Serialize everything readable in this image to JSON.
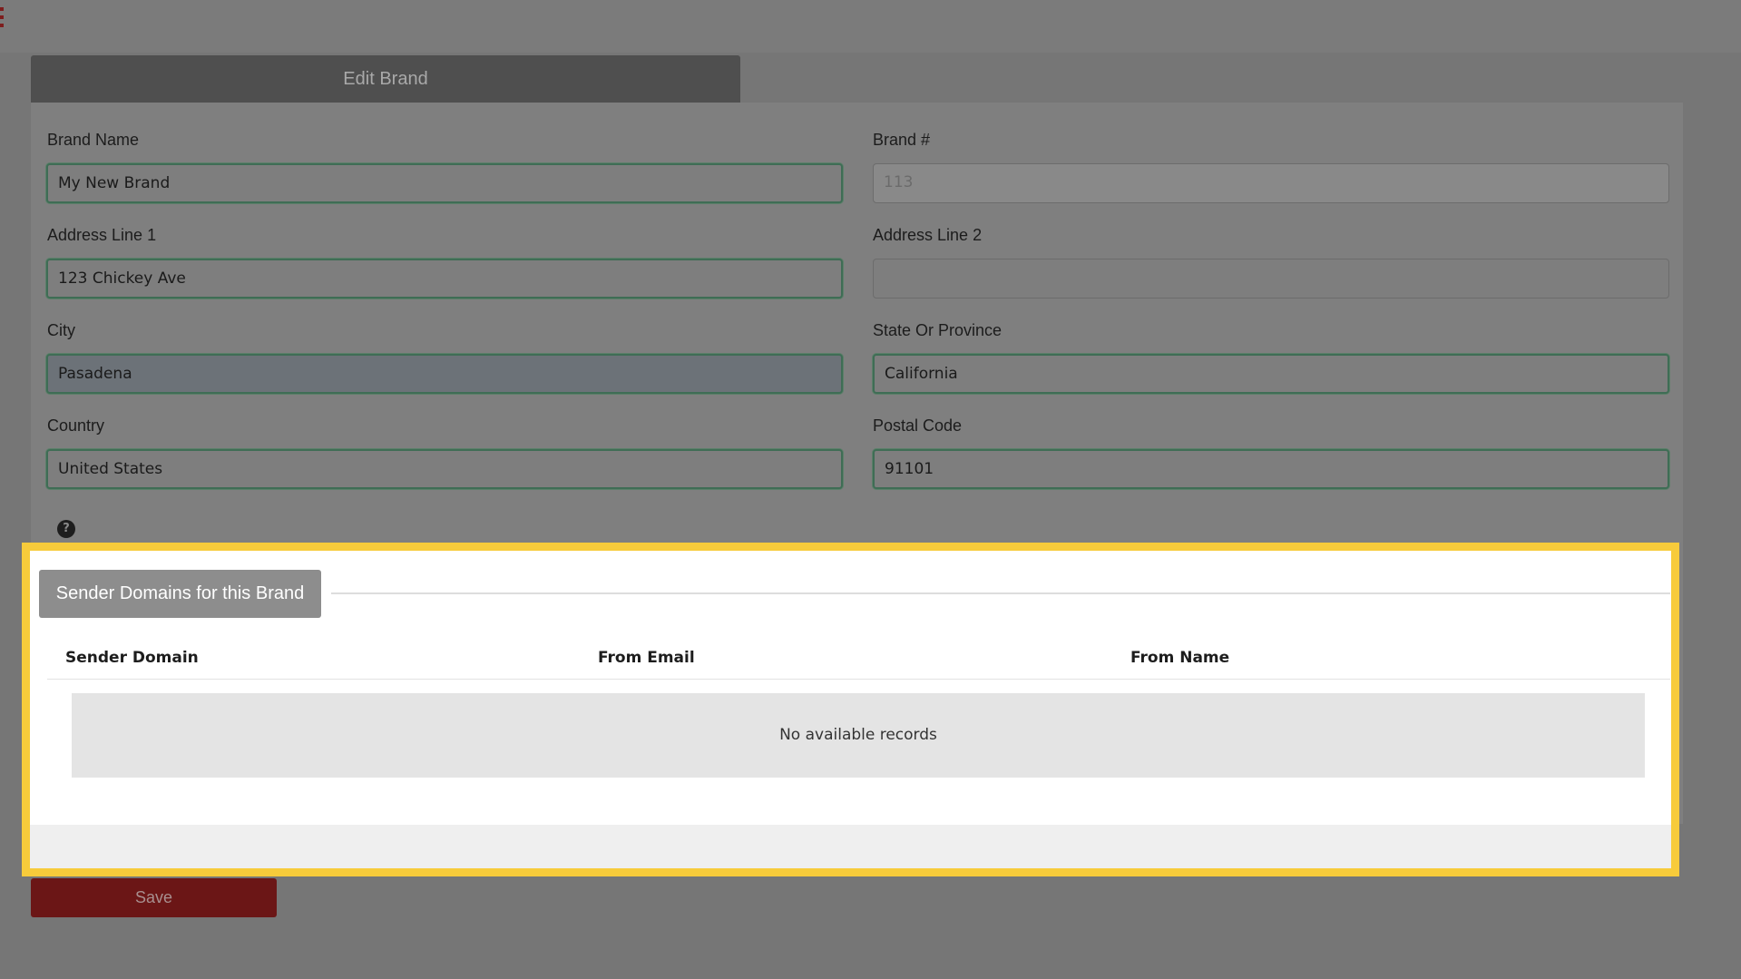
{
  "panel": {
    "title": "Edit Brand"
  },
  "form": {
    "brand_name": {
      "label": "Brand Name",
      "value": "My New Brand"
    },
    "brand_number": {
      "label": "Brand #",
      "value": "113"
    },
    "address_line_1": {
      "label": "Address Line 1",
      "value": "123 Chickey Ave"
    },
    "address_line_2": {
      "label": "Address Line 2",
      "value": ""
    },
    "city": {
      "label": "City",
      "value": "Pasadena"
    },
    "state": {
      "label": "State Or Province",
      "value": "California"
    },
    "country": {
      "label": "Country",
      "value": "United States"
    },
    "postal_code": {
      "label": "Postal Code",
      "value": "91101"
    },
    "help_icon": "question-icon"
  },
  "sender_domains": {
    "title": "Sender Domains for this Brand",
    "columns": [
      "Sender Domain",
      "From Email",
      "From Name"
    ],
    "empty_message": "No available records"
  },
  "actions": {
    "save_label": "Save"
  },
  "colors": {
    "highlight_border": "#f7cb3b",
    "save_button": "#6b1616",
    "input_focus_border": "#3f6d55"
  }
}
